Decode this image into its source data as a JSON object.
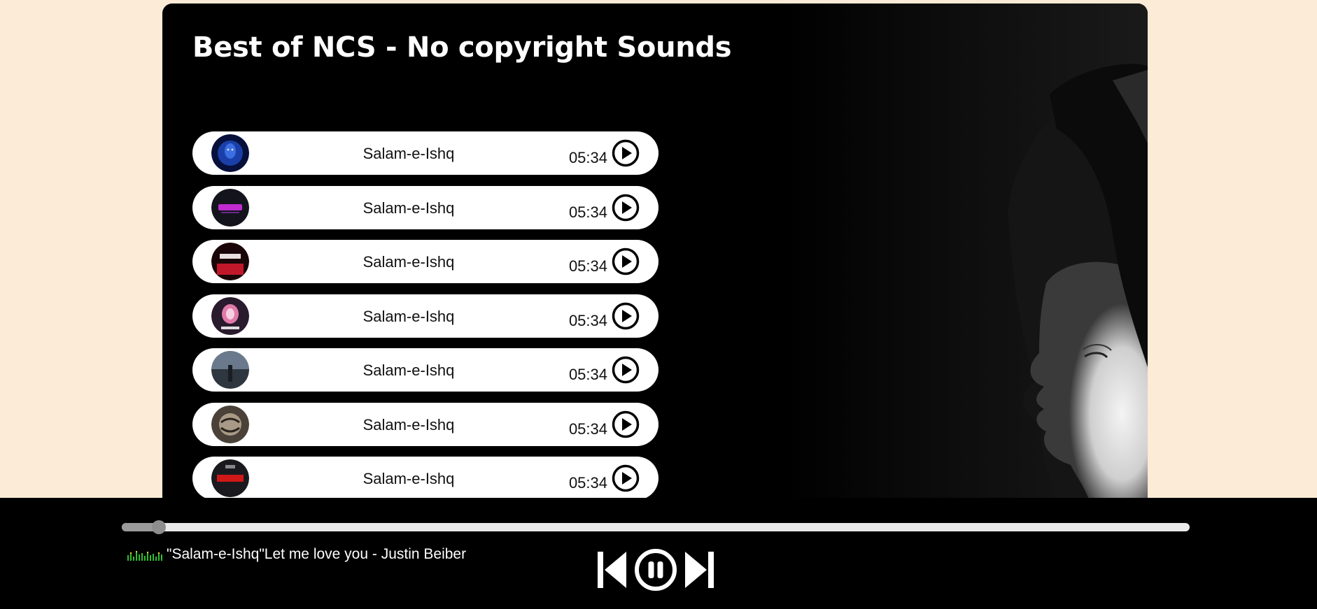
{
  "playlist": {
    "title": "Best of NCS - No copyright Sounds"
  },
  "songs": [
    {
      "name": "Salam-e-Ishq",
      "duration": "05:34",
      "cover_color": "#1a3fa8"
    },
    {
      "name": "Salam-e-Ishq",
      "duration": "05:34",
      "cover_color": "#c02ad0"
    },
    {
      "name": "Salam-e-Ishq",
      "duration": "05:34",
      "cover_color": "#c0182a"
    },
    {
      "name": "Salam-e-Ishq",
      "duration": "05:34",
      "cover_color": "#e07aa8"
    },
    {
      "name": "Salam-e-Ishq",
      "duration": "05:34",
      "cover_color": "#6a7a8c"
    },
    {
      "name": "Salam-e-Ishq",
      "duration": "05:34",
      "cover_color": "#a89a86"
    },
    {
      "name": "Salam-e-Ishq",
      "duration": "05:34",
      "cover_color": "#d01818"
    }
  ],
  "player": {
    "now_playing": "\"Salam-e-Ishq\"Let me love you - Justin Beiber",
    "progress_percent": 3.5,
    "state": "playing"
  },
  "icons": {
    "song_play": "play-circle-icon",
    "previous": "skip-previous-icon",
    "pause": "pause-circle-icon",
    "next": "skip-next-icon",
    "equalizer": "equalizer-icon"
  },
  "colors": {
    "page_background": "#fcebd6",
    "panel": "#000000",
    "list_item": "#ffffff",
    "equalizer": "#2fbf2f"
  }
}
